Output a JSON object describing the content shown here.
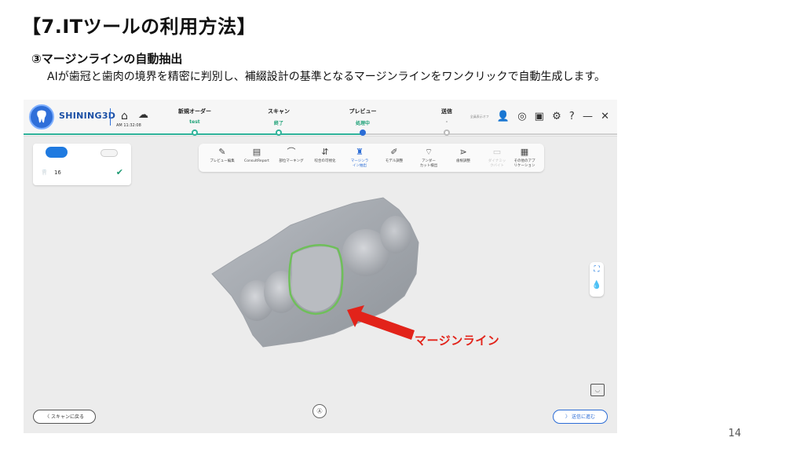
{
  "slide": {
    "title": "【7.ITツールの利用方法】",
    "subtitle": "③マージンラインの自動抽出",
    "description": "AIが歯冠と歯肉の境界を精密に判別し、補綴設計の基準となるマージンラインをワンクリックで自動生成します。",
    "page_number": "14"
  },
  "app": {
    "brand": "SHINING3D",
    "clock": "AM 11:32:08",
    "steps": [
      {
        "label": "新規オーダー",
        "status": "test"
      },
      {
        "label": "スキャン",
        "status": "終了"
      },
      {
        "label": "プレビュー",
        "status": "処理中"
      },
      {
        "label": "送信",
        "status": "-"
      }
    ],
    "tools_right_small": "全員表示オフ"
  },
  "tooth_panel": {
    "tooth_number": "16"
  },
  "toolbar": {
    "tools": [
      {
        "label": "プレビュー編集"
      },
      {
        "label": "ConsultReport"
      },
      {
        "label": "部位マーキング"
      },
      {
        "label": "咬合の可視化"
      },
      {
        "label": "マージンラ\nイン抽出"
      },
      {
        "label": "モデル調整"
      },
      {
        "label": "アンダー\nカット検出"
      },
      {
        "label": "歯根調整"
      },
      {
        "label": "ダイナミッ\nクバイト"
      },
      {
        "label": "その他のアプ\nリケーション"
      }
    ],
    "active_index": 4
  },
  "annotation": {
    "margin_label": "マージンライン"
  },
  "buttons": {
    "back": "〈 スキャンに戻る",
    "next": "〉 送信に進む",
    "auto": "Ⓐ"
  },
  "colors": {
    "accent": "#2b6cd6",
    "progress": "#2fb39a",
    "arrow": "#e2231a",
    "margin_line": "#6fbf5a"
  }
}
